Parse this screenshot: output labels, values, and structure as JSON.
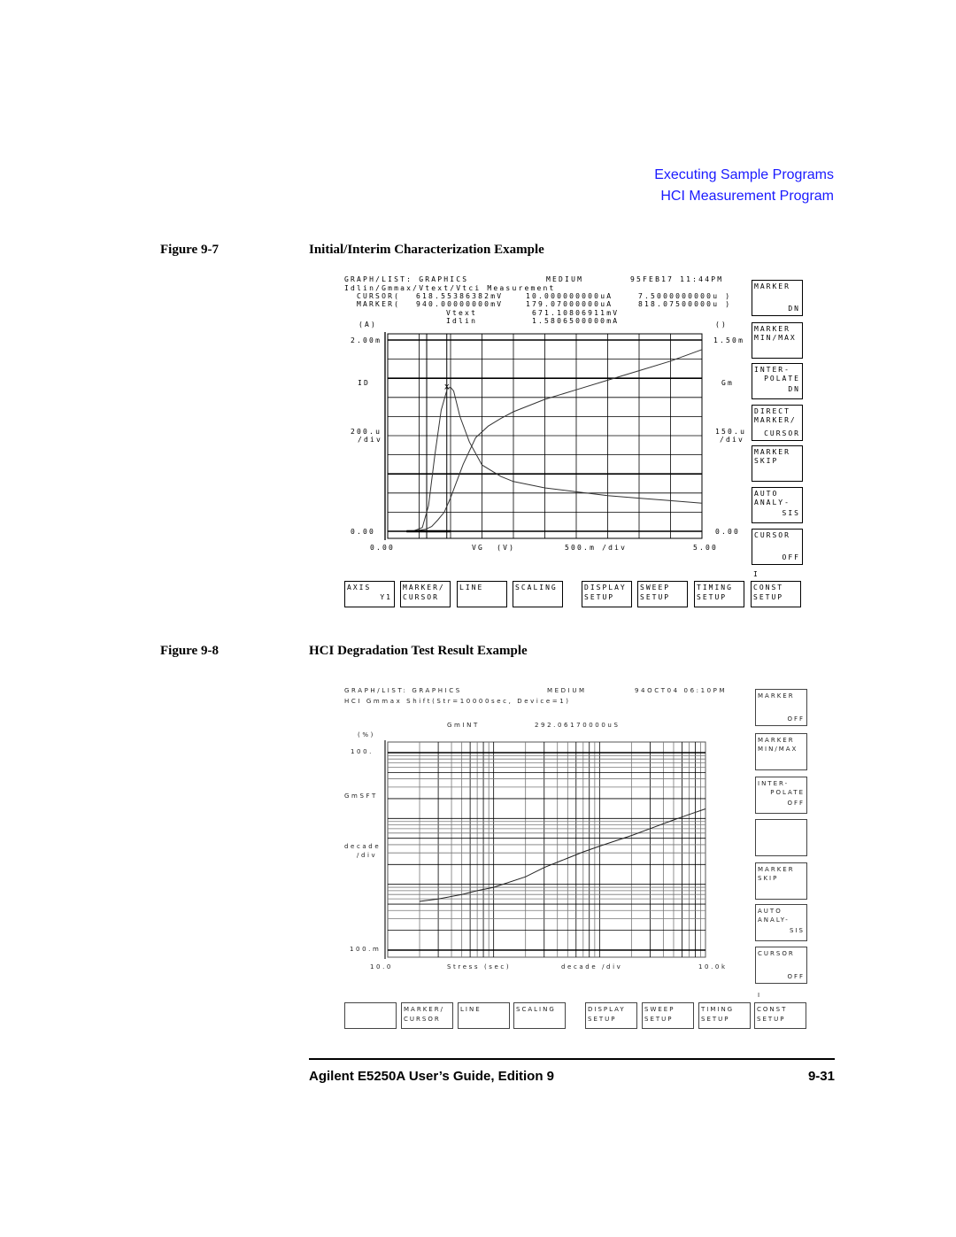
{
  "header": {
    "section": "Executing Sample Programs",
    "subsection": "HCI Measurement Program"
  },
  "figures": [
    {
      "number": "Figure 9-7",
      "title": "Initial/Interim Characterization Example",
      "screen": {
        "status_line": "GRAPH/LIST: GRAPHICS",
        "mode": "MEDIUM",
        "datetime": "95FEB17 11:44PM",
        "measurement": "Idlin/Gmmax/Vtext/Vtci Measurement",
        "cursor_row": {
          "label": "CURSOR(",
          "v1": "618.55386382mV",
          "v2": "10.000000000uA",
          "v3": "7.5000000000u )"
        },
        "marker_row": {
          "label": "MARKER(",
          "v1": "940.00000000mV",
          "v2": "179.07000000uA",
          "v3": "818.07500000u )"
        },
        "param1": {
          "name": "Vtext",
          "value": "671.10806911mV"
        },
        "param2": {
          "name": "Idlin",
          "value": "1.5806500000mA"
        },
        "y1_unit": "(A)",
        "y2_unit": "()",
        "y1_top": "2.00m",
        "y1_name": "ID",
        "y1_div": "200.u",
        "y1_div2": "/div",
        "y1_bottom": "0.00",
        "y2_top": "1.50m",
        "y2_name": "Gm",
        "y2_div": "150.u",
        "y2_div2": "/div",
        "y2_bottom": "0.00",
        "x_left": "0.00",
        "x_name": "VG  (V)",
        "x_div": "500.m /div",
        "x_right": "5.00",
        "cursor_mark": "I",
        "side_keys": [
          {
            "l1": "MARKER",
            "l2": "",
            "l3": "DN"
          },
          {
            "l1": "MARKER",
            "l2": "MIN/MAX",
            "l3": ""
          },
          {
            "l1": "INTER-",
            "l2": "POLATE",
            "l3": "DN"
          },
          {
            "l1": "DIRECT",
            "l2": "MARKER/",
            "l3": "CURSOR"
          },
          {
            "l1": "MARKER",
            "l2": "SKIP",
            "l3": ""
          },
          {
            "l1": "AUTO",
            "l2": "ANALY-",
            "l3": "SIS"
          },
          {
            "l1": "CURSOR",
            "l2": "",
            "l3": "OFF"
          }
        ],
        "bottom_keys": [
          {
            "l1": "AXIS",
            "l2": "Y1"
          },
          {
            "l1": "MARKER/",
            "l2": "CURSOR"
          },
          {
            "l1": "LINE",
            "l2": ""
          },
          {
            "l1": "SCALING",
            "l2": ""
          },
          {
            "l1": "DISPLAY",
            "l2": "SETUP"
          },
          {
            "l1": "SWEEP",
            "l2": "SETUP"
          },
          {
            "l1": "TIMING",
            "l2": "SETUP"
          },
          {
            "l1": "CONST",
            "l2": "SETUP"
          }
        ]
      }
    },
    {
      "number": "Figure 9-8",
      "title": "HCI Degradation Test Result Example",
      "screen": {
        "status_line": "GRAPH/LIST: GRAPHICS",
        "mode": "MEDIUM",
        "datetime": "94OCT04 06:10PM",
        "measurement": "HCI Gmmax Shift(Str=10000sec, Device=1)",
        "param1": {
          "name": "GmINT",
          "value": "292.06170000uS"
        },
        "y_unit": "(%)",
        "y_top": "100.",
        "y_name": "GmSFT",
        "y_div": "decade",
        "y_div2": "/div",
        "y_bottom": "100.m",
        "x_left": "10.0",
        "x_name": "Stress (sec)",
        "x_div": "decade /div",
        "x_right": "10.0k",
        "cursor_mark": "I",
        "side_keys": [
          {
            "l1": "MARKER",
            "l2": "",
            "l3": "OFF"
          },
          {
            "l1": "MARKER",
            "l2": "MIN/MAX",
            "l3": ""
          },
          {
            "l1": "INTER-",
            "l2": "POLATE",
            "l3": "OFF"
          },
          {
            "l1": "",
            "l2": "",
            "l3": ""
          },
          {
            "l1": "MARKER",
            "l2": "SKIP",
            "l3": ""
          },
          {
            "l1": "AUTO",
            "l2": "ANALY-",
            "l3": "SIS"
          },
          {
            "l1": "CURSOR",
            "l2": "",
            "l3": "OFF"
          }
        ],
        "bottom_keys": [
          {
            "l1": "",
            "l2": ""
          },
          {
            "l1": "MARKER/",
            "l2": "CURSOR"
          },
          {
            "l1": "LINE",
            "l2": ""
          },
          {
            "l1": "SCALING",
            "l2": ""
          },
          {
            "l1": "DISPLAY",
            "l2": "SETUP"
          },
          {
            "l1": "SWEEP",
            "l2": "SETUP"
          },
          {
            "l1": "TIMING",
            "l2": "SETUP"
          },
          {
            "l1": "CONST",
            "l2": "SETUP"
          }
        ]
      }
    }
  ],
  "chart_data": [
    {
      "type": "line",
      "title": "Idlin/Gmmax/Vtext/Vtci Measurement",
      "xlabel": "VG (V)",
      "xlim": [
        0,
        5
      ],
      "x_ticks": [
        "0.00",
        "5.00"
      ],
      "grid": true,
      "series": [
        {
          "name": "ID",
          "axis": "left",
          "unit": "A",
          "ylim": [
            0,
            0.002
          ],
          "x": [
            0.4,
            0.6,
            0.7,
            0.8,
            0.9,
            1.0,
            1.2,
            1.4,
            1.6,
            1.8,
            2.0,
            2.5,
            3.0,
            3.5,
            4.0,
            4.5,
            5.0
          ],
          "y": [
            0.0,
            2e-05,
            5e-05,
            0.00012,
            0.0002,
            0.00035,
            0.0007,
            0.00098,
            0.0011,
            0.00118,
            0.00125,
            0.00138,
            0.00148,
            0.00158,
            0.00168,
            0.00178,
            0.0019
          ]
        },
        {
          "name": "Gm",
          "axis": "right",
          "unit": "",
          "ylim": [
            0,
            0.0015
          ],
          "x": [
            0.4,
            0.55,
            0.65,
            0.75,
            0.85,
            0.95,
            1.0,
            1.05,
            1.15,
            1.3,
            1.5,
            1.8,
            2.0,
            2.5,
            3.0,
            3.5,
            4.0,
            4.5,
            5.0
          ],
          "y": [
            0.0,
            3e-05,
            0.0002,
            0.0006,
            0.00095,
            0.00112,
            0.00113,
            0.0011,
            0.0009,
            0.0007,
            0.00052,
            0.00043,
            0.00039,
            0.00034,
            0.00031,
            0.00028,
            0.00026,
            0.00024,
            0.00022
          ]
        }
      ],
      "marker": {
        "x": 0.94,
        "label": "x"
      },
      "cursor": {
        "x": 0.62
      }
    },
    {
      "type": "line",
      "title": "HCI Gmmax Shift(Str=10000sec, Device=1)",
      "xlabel": "Stress (sec)",
      "ylabel": "GmSFT (%)",
      "x_scale": "log",
      "y_scale": "log",
      "xlim": [
        10,
        10000
      ],
      "ylim": [
        0.1,
        100
      ],
      "x_ticks": [
        "10.0",
        "10.0k"
      ],
      "y_ticks": [
        "100.m",
        "100."
      ],
      "grid": true,
      "series": [
        {
          "name": "GmSFT",
          "x": [
            20,
            30,
            50,
            70,
            100,
            200,
            300,
            500,
            700,
            1000,
            2000,
            3000,
            5000,
            7000,
            10000
          ],
          "y": [
            0.55,
            0.6,
            0.7,
            0.8,
            0.9,
            1.3,
            1.8,
            2.5,
            3.1,
            3.8,
            5.5,
            7.0,
            9.5,
            11.5,
            14.0
          ]
        }
      ]
    }
  ]
}
